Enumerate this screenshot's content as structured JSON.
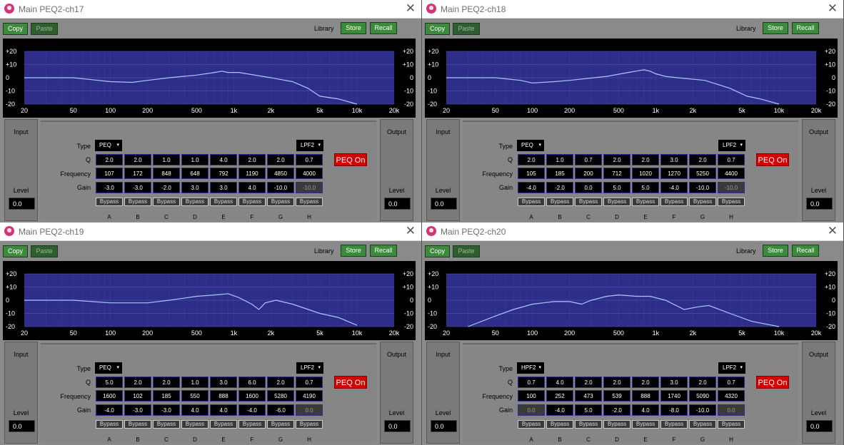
{
  "common": {
    "copy": "Copy",
    "paste": "Paste",
    "library": "Library",
    "store": "Store",
    "recall": "Recall",
    "type_label": "Type",
    "q_label": "Q",
    "freq_label": "Frequency",
    "gain_label": "Gain",
    "input_label": "Input",
    "output_label": "Output",
    "level_label": "Level",
    "bypass": "Bypass",
    "peq_on": "PEQ On",
    "close_glyph": "✕",
    "bands": [
      "A",
      "B",
      "C",
      "D",
      "E",
      "F",
      "G",
      "H"
    ],
    "graph_y_labels": [
      "+20",
      "+10",
      "0",
      "-10",
      "-20"
    ],
    "graph_x_labels": [
      "20",
      "50",
      "100",
      "200",
      "500",
      "1k",
      "2k",
      "5k",
      "10k",
      "20k"
    ],
    "colors": {
      "plot_bg": "#2e2e8a",
      "curve": "#a8c8ff",
      "grid": "#5a5ab0",
      "peq_on": "#d40000",
      "button": "#3c8a3c"
    },
    "icons": {
      "app": "app-icon",
      "close": "close-icon",
      "dropdown": "dropdown-arrow-icon"
    }
  },
  "windows": [
    {
      "title": "Main PEQ2-ch17",
      "dropdown_arrow": "▾",
      "type_low": "PEQ",
      "type_high": "LPF2",
      "q": [
        "2.0",
        "2.0",
        "1.0",
        "1.0",
        "4.0",
        "2.0",
        "2.0",
        "0.7"
      ],
      "freq": [
        "107",
        "172",
        "848",
        "648",
        "792",
        "1190",
        "4850",
        "4000"
      ],
      "gain": [
        "-3.0",
        "-3.0",
        "-2.0",
        "3.0",
        "3.0",
        "4.0",
        "-10.0",
        "-10.0"
      ],
      "input_level": "0.0",
      "output_level": "0.0",
      "curve": [
        [
          20,
          0
        ],
        [
          50,
          0
        ],
        [
          100,
          -3
        ],
        [
          150,
          -3.5
        ],
        [
          200,
          -2
        ],
        [
          300,
          0
        ],
        [
          500,
          2
        ],
        [
          700,
          4
        ],
        [
          800,
          5
        ],
        [
          900,
          4
        ],
        [
          1100,
          4
        ],
        [
          2000,
          0
        ],
        [
          3000,
          -3
        ],
        [
          4000,
          -8
        ],
        [
          5000,
          -14
        ],
        [
          7000,
          -16
        ],
        [
          10000,
          -20
        ]
      ]
    },
    {
      "title": "Main PEQ2-ch18",
      "dropdown_arrow": "▾",
      "type_low": "PEQ",
      "type_high": "LPF2",
      "q": [
        "2.0",
        "1.0",
        "0.7",
        "2.0",
        "2.0",
        "3.0",
        "2.0",
        "0.7"
      ],
      "freq": [
        "105",
        "185",
        "200",
        "712",
        "1020",
        "1270",
        "5250",
        "4400"
      ],
      "gain": [
        "-4.0",
        "-2.0",
        "0.0",
        "5.0",
        "5.0",
        "-4.0",
        "-10.0",
        "-10.0"
      ],
      "input_level": "0.0",
      "output_level": "0.0",
      "curve": [
        [
          20,
          0
        ],
        [
          50,
          0
        ],
        [
          80,
          -2
        ],
        [
          100,
          -4
        ],
        [
          150,
          -3
        ],
        [
          200,
          -2
        ],
        [
          400,
          1
        ],
        [
          600,
          4
        ],
        [
          800,
          6
        ],
        [
          900,
          5
        ],
        [
          1000,
          3
        ],
        [
          1200,
          1
        ],
        [
          1500,
          0
        ],
        [
          2500,
          -2
        ],
        [
          4000,
          -8
        ],
        [
          5500,
          -14
        ],
        [
          7000,
          -16
        ],
        [
          10000,
          -20
        ]
      ]
    },
    {
      "title": "Main PEQ2-ch19",
      "dropdown_arrow": "▾",
      "type_low": "PEQ",
      "type_high": "LPF2",
      "q": [
        "5.0",
        "2.0",
        "2.0",
        "1.0",
        "3.0",
        "6.0",
        "2.0",
        "0.7"
      ],
      "freq": [
        "1600",
        "102",
        "185",
        "550",
        "888",
        "1600",
        "5280",
        "4190"
      ],
      "gain": [
        "-4.0",
        "-3.0",
        "-3.0",
        "4.0",
        "4.0",
        "-4.0",
        "-6.0",
        "0.0"
      ],
      "input_level": "0.0",
      "output_level": "0.0",
      "curve": [
        [
          20,
          0
        ],
        [
          50,
          0
        ],
        [
          100,
          -2
        ],
        [
          200,
          -2
        ],
        [
          300,
          0
        ],
        [
          500,
          3
        ],
        [
          700,
          4
        ],
        [
          900,
          5
        ],
        [
          1100,
          2
        ],
        [
          1400,
          -3
        ],
        [
          1600,
          -7
        ],
        [
          1800,
          -2
        ],
        [
          2200,
          0
        ],
        [
          3000,
          -3
        ],
        [
          5000,
          -10
        ],
        [
          7000,
          -13
        ],
        [
          10000,
          -19
        ]
      ]
    },
    {
      "title": "Main PEQ2-ch20",
      "dropdown_arrow": "▾",
      "type_low": "HPF2",
      "type_high": "LPF2",
      "q": [
        "0.7",
        "4.0",
        "2.0",
        "2.0",
        "2.0",
        "3.0",
        "2.0",
        "0.7"
      ],
      "freq": [
        "100",
        "252",
        "473",
        "539",
        "888",
        "1740",
        "5090",
        "4320"
      ],
      "gain": [
        "0.0",
        "-4.0",
        "5.0",
        "-2.0",
        "4.0",
        "-8.0",
        "-10.0",
        "0.0"
      ],
      "input_level": "0.0",
      "output_level": "0.0",
      "curve": [
        [
          30,
          -20
        ],
        [
          50,
          -12
        ],
        [
          70,
          -7
        ],
        [
          100,
          -3
        ],
        [
          150,
          -1
        ],
        [
          200,
          -1
        ],
        [
          250,
          -3
        ],
        [
          300,
          0
        ],
        [
          400,
          3
        ],
        [
          500,
          4
        ],
        [
          700,
          3
        ],
        [
          900,
          3
        ],
        [
          1200,
          0
        ],
        [
          1700,
          -7
        ],
        [
          2200,
          -5
        ],
        [
          2700,
          -4
        ],
        [
          4000,
          -10
        ],
        [
          6000,
          -16
        ],
        [
          10000,
          -20
        ]
      ]
    }
  ]
}
